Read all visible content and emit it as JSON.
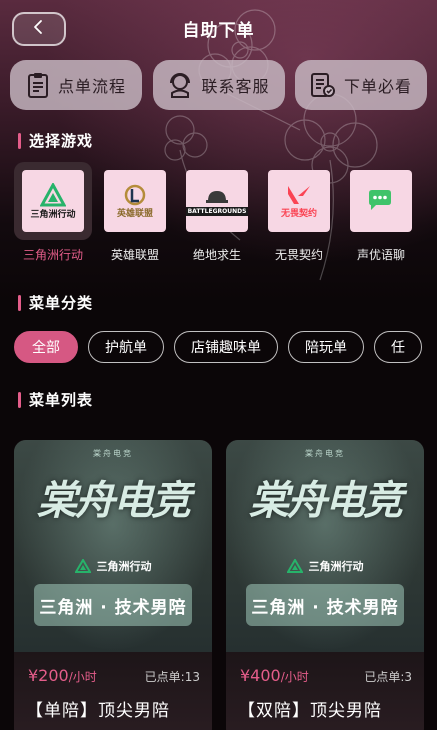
{
  "header": {
    "title": "自助下单",
    "back_icon": "chevron-left-icon"
  },
  "quick_actions": [
    {
      "label": "点单流程",
      "icon": "clipboard-icon"
    },
    {
      "label": "联系客服",
      "icon": "headset-icon"
    },
    {
      "label": "下单必看",
      "icon": "checklist-icon"
    }
  ],
  "sections": {
    "games": "选择游戏",
    "categories": "菜单分类",
    "list": "菜单列表"
  },
  "games": [
    {
      "name": "三角洲行动",
      "logo_text": "三角洲行动",
      "selected": true
    },
    {
      "name": "英雄联盟",
      "logo_text": "英雄联盟"
    },
    {
      "name": "绝地求生",
      "logo_text": "BATTLEGROUNDS"
    },
    {
      "name": "无畏契约",
      "logo_text": "无畏契约"
    },
    {
      "name": "声优语聊",
      "logo_text": ""
    }
  ],
  "categories": [
    {
      "label": "全部",
      "active": true
    },
    {
      "label": "护航单"
    },
    {
      "label": "店铺趣味单"
    },
    {
      "label": "陪玩单"
    },
    {
      "label": "任"
    }
  ],
  "cards": [
    {
      "poster_small": "棠舟电竞",
      "poster_big": "棠舟电竞",
      "poster_logo": "三角洲行动",
      "poster_subtitle": "三角洲 · 技术男陪",
      "price": "¥200",
      "unit": "/小时",
      "orders": "已点单:13",
      "title": "【单陪】顶尖男陪"
    },
    {
      "poster_small": "棠舟电竞",
      "poster_big": "棠舟电竞",
      "poster_logo": "三角洲行动",
      "poster_subtitle": "三角洲 · 技术男陪",
      "price": "¥400",
      "unit": "/小时",
      "orders": "已点单:3",
      "title": "【双陪】顶尖男陪"
    }
  ],
  "colors": {
    "accent": "#e45d8a",
    "chip_active": "#d65883",
    "background": "#0b0608"
  }
}
